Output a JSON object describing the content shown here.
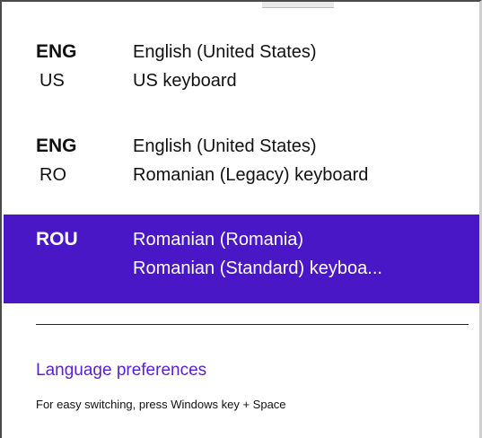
{
  "languages": [
    {
      "abbr": "ENG",
      "region": "US",
      "language": "English (United States)",
      "keyboard": "US keyboard",
      "selected": false
    },
    {
      "abbr": "ENG",
      "region": "RO",
      "language": "English (United States)",
      "keyboard": "Romanian (Legacy) keyboard",
      "selected": false
    },
    {
      "abbr": "ROU",
      "region": "",
      "language": "Romanian (Romania)",
      "keyboard": "Romanian (Standard) keyboa...",
      "selected": true
    }
  ],
  "footer": {
    "link_label": "Language preferences",
    "hint": "For easy switching, press Windows key + Space"
  },
  "colors": {
    "selected_background": "#4a17c7",
    "link": "#5a1fd0"
  }
}
